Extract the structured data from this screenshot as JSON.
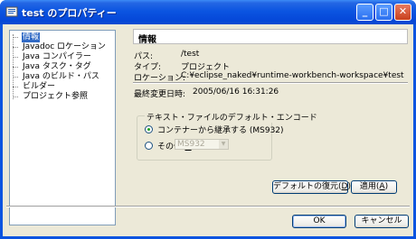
{
  "window": {
    "title": "test のプロパティー"
  },
  "titlebar_buttons": {
    "minimize": "_",
    "maximize": "□",
    "close": "✕"
  },
  "tree": {
    "items": [
      {
        "label": "情報"
      },
      {
        "label": "Javadoc ロケーション"
      },
      {
        "label": "Java コンパイラー"
      },
      {
        "label": "Java タスク・タグ"
      },
      {
        "label": "Java のビルド・パス"
      },
      {
        "label": "ビルダー"
      },
      {
        "label": "プロジェクト参照"
      }
    ],
    "selected_index": 0
  },
  "page": {
    "title": "情報",
    "path_label": "パス:",
    "path_value": "/test",
    "type_label": "タイプ:",
    "type_value": "プロジェクト",
    "location_label": "ロケーション:",
    "location_value": "C:¥eclipse_naked¥runtime-workbench-workspace¥test",
    "modified_label": "最終変更日時:",
    "modified_value": "2005/06/16 16:31:26"
  },
  "encoding": {
    "group_label": "テキスト・ファイルのデフォルト・エンコード",
    "inherit_label": "コンテナーから継承する (MS932)",
    "inherit_selected": true,
    "other_label_pre": "その他(",
    "other_label_key": "Q",
    "other_label_post": "):",
    "other_value": "MS932"
  },
  "buttons": {
    "restore_pre": "デフォルトの復元(",
    "restore_key": "D",
    "restore_post": ")",
    "apply_pre": "適用(",
    "apply_key": "A",
    "apply_post": ")",
    "ok": "OK",
    "cancel": "キャンセル"
  },
  "colors": {
    "titlebar": "#0a54e0",
    "selection": "#316ac5",
    "face": "#ece9d8"
  }
}
